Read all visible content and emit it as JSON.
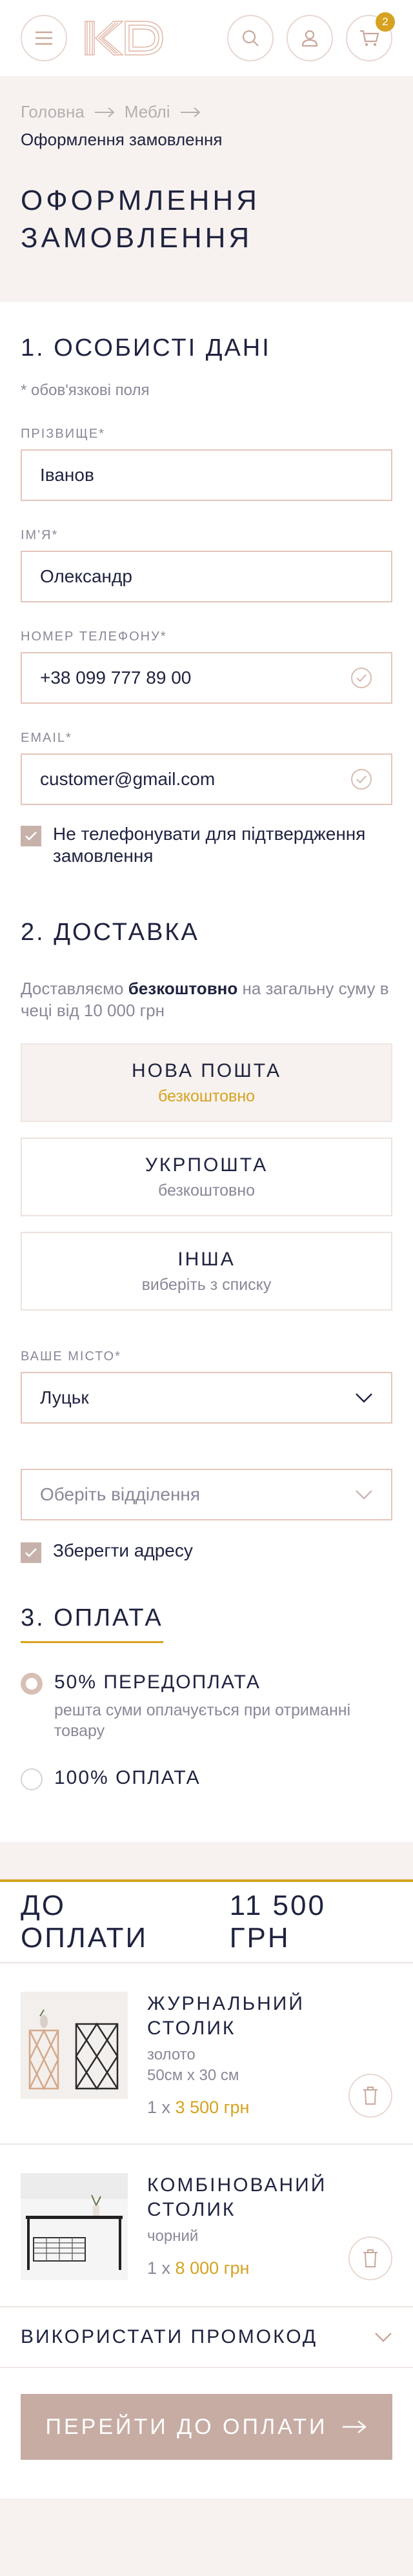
{
  "header": {
    "cart_count": "2",
    "logo_text": "KD"
  },
  "breadcrumb": {
    "items": [
      "Головна",
      "Меблі"
    ],
    "current": "Оформлення замовлення"
  },
  "page_title_line1": "ОФОРМЛЕННЯ",
  "page_title_line2": "ЗАМОВЛЕННЯ",
  "personal": {
    "title": "1. ОСОБИСТІ ДАНІ",
    "required_note": "* обов'язкові поля",
    "surname_label": "ПРІЗВИЩЕ*",
    "surname_value": "Іванов",
    "name_label": "ІМ'Я*",
    "name_value": "Олександр",
    "phone_label": "НОМЕР ТЕЛЕФОНУ*",
    "phone_value": "+38 099 777 89 00",
    "email_label": "EMAIL*",
    "email_value": "customer@gmail.com",
    "no_call_label": "Не телефонувати для підтвердження замовлення"
  },
  "delivery": {
    "title": "2. ДОСТАВКА",
    "note_prefix": "Доставляємо",
    "note_bold": "безкоштовно",
    "note_suffix": "на загальну суму в чеці  від 10 000 грн",
    "options": [
      {
        "title": "НОВА ПОШТА",
        "sub": "безкоштовно"
      },
      {
        "title": "УКРПОШТА",
        "sub": "безкоштовно"
      },
      {
        "title": "ІНША",
        "sub": "виберіть з списку"
      }
    ],
    "city_label": "ВАШЕ МІСТО*",
    "city_value": "Луцьк",
    "branch_placeholder": "Оберіть відділення",
    "save_address_label": "Зберегти адресу"
  },
  "payment": {
    "title": "3. ОПЛАТА",
    "option1_title": "50% ПЕРЕДОПЛАТА",
    "option1_sub": "решта суми оплачується при отриманні товару",
    "option2_title": "100% ОПЛАТА"
  },
  "summary": {
    "total_label": "ДО ОПЛАТИ",
    "total_value": "11 500 ГРН",
    "products": [
      {
        "name": "ЖУРНАЛЬНИЙ СТОЛИК",
        "color": "золото",
        "size": "50см х 30 см",
        "qty": "1 х",
        "price": "3 500 грн"
      },
      {
        "name": "КОМБІНОВАНИЙ СТОЛИК",
        "color": "чорний",
        "size": "",
        "qty": "1 х",
        "price": "8 000 грн"
      }
    ],
    "promo_label": "ВИКОРИСТАТИ ПРОМОКОД",
    "cta_label": "ПЕРЕЙТИ ДО ОПЛАТИ"
  },
  "colors": {
    "accent_gold": "#d6a21f",
    "cta_bg": "#c7aca4",
    "input_border": "#e4c5ba",
    "page_bg": "#f7f2ef",
    "text_dark": "#1f2340"
  }
}
